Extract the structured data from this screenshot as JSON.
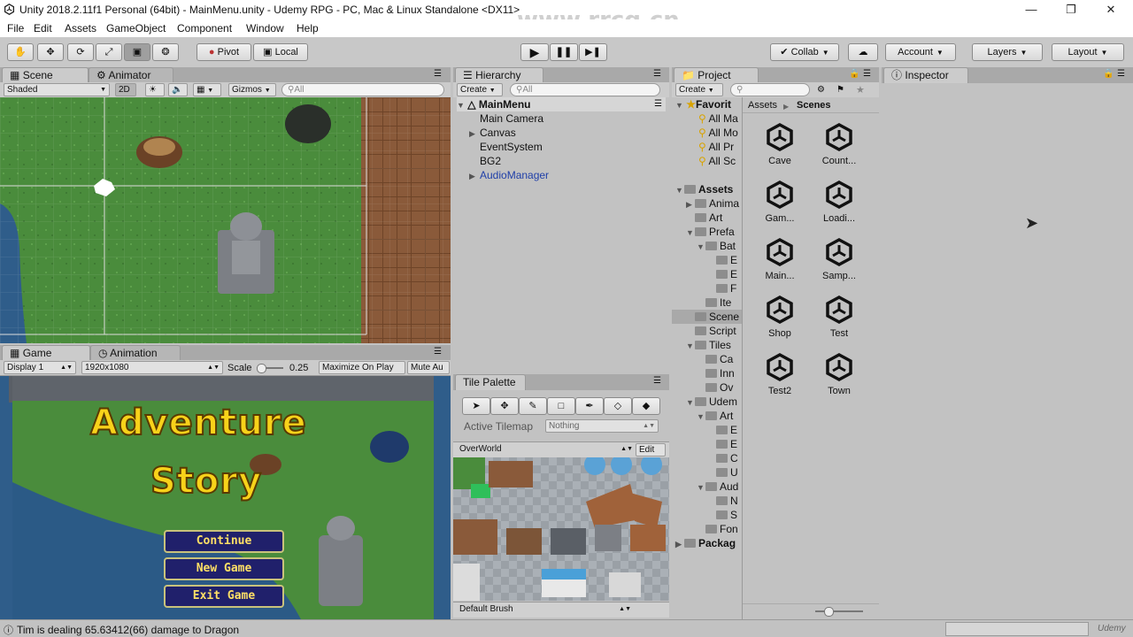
{
  "window": {
    "title": "Unity 2018.2.11f1 Personal (64bit) - MainMenu.unity - Udemy RPG - PC, Mac & Linux Standalone <DX11>"
  },
  "watermark": {
    "text": "www.rrcg.cn"
  },
  "menu": [
    "File",
    "Edit",
    "Assets",
    "GameObject",
    "Component",
    "Window",
    "Help"
  ],
  "toolbar": {
    "pivot": "Pivot",
    "local": "Local",
    "collab": "Collab",
    "account": "Account",
    "layers": "Layers",
    "layout": "Layout"
  },
  "scene_panel": {
    "tabs": [
      "Scene",
      "Animator"
    ],
    "shading": "Shaded",
    "mode2d": "2D",
    "gizmos": "Gizmos",
    "search_placeholder": "All"
  },
  "game_panel": {
    "tabs": [
      "Game",
      "Animation"
    ],
    "display": "Display 1",
    "resolution": "1920x1080",
    "scale_label": "Scale",
    "scale_value": "0.25",
    "maximize": "Maximize On Play",
    "mute": "Mute Au",
    "title_line1": "Adventure",
    "title_line2": "Story",
    "buttons": [
      "Continue",
      "New Game",
      "Exit Game"
    ]
  },
  "hierarchy": {
    "tab": "Hierarchy",
    "create": "Create",
    "search_placeholder": "All",
    "scene": "MainMenu",
    "items": [
      {
        "label": "Main Camera",
        "expandable": false,
        "prefab": false
      },
      {
        "label": "Canvas",
        "expandable": true,
        "prefab": false
      },
      {
        "label": "EventSystem",
        "expandable": false,
        "prefab": false
      },
      {
        "label": "BG2",
        "expandable": false,
        "prefab": false
      },
      {
        "label": "AudioManager",
        "expandable": true,
        "prefab": true
      }
    ]
  },
  "tile_palette": {
    "tab": "Tile Palette",
    "active_tilemap_label": "Active Tilemap",
    "active_tilemap_value": "Nothing",
    "palette": "OverWorld",
    "edit": "Edit",
    "brush": "Default Brush"
  },
  "project": {
    "tab": "Project",
    "create": "Create",
    "breadcrumb": [
      "Assets",
      "Scenes"
    ],
    "favorites_label": "Favorit",
    "favorites": [
      "All Ma",
      "All Mo",
      "All Pr",
      "All Sc"
    ],
    "tree": [
      {
        "label": "Assets",
        "depth": 0,
        "bold": true,
        "arrow": "down"
      },
      {
        "label": "Anima",
        "depth": 1,
        "arrow": "right"
      },
      {
        "label": "Art",
        "depth": 1,
        "arrow": ""
      },
      {
        "label": "Prefa",
        "depth": 1,
        "arrow": "down"
      },
      {
        "label": "Bat",
        "depth": 2,
        "arrow": "down"
      },
      {
        "label": "E",
        "depth": 3,
        "arrow": ""
      },
      {
        "label": "E",
        "depth": 3,
        "arrow": ""
      },
      {
        "label": "F",
        "depth": 3,
        "arrow": ""
      },
      {
        "label": "Ite",
        "depth": 2,
        "arrow": ""
      },
      {
        "label": "Scene",
        "depth": 1,
        "arrow": "",
        "selected": true
      },
      {
        "label": "Script",
        "depth": 1,
        "arrow": ""
      },
      {
        "label": "Tiles",
        "depth": 1,
        "arrow": "down"
      },
      {
        "label": "Ca",
        "depth": 2,
        "arrow": ""
      },
      {
        "label": "Inn",
        "depth": 2,
        "arrow": ""
      },
      {
        "label": "Ov",
        "depth": 2,
        "arrow": ""
      },
      {
        "label": "Udem",
        "depth": 1,
        "arrow": "down"
      },
      {
        "label": "Art",
        "depth": 2,
        "arrow": "down"
      },
      {
        "label": "E",
        "depth": 3,
        "arrow": ""
      },
      {
        "label": "E",
        "depth": 3,
        "arrow": ""
      },
      {
        "label": "C",
        "depth": 3,
        "arrow": ""
      },
      {
        "label": "U",
        "depth": 3,
        "arrow": ""
      },
      {
        "label": "Aud",
        "depth": 2,
        "arrow": "down"
      },
      {
        "label": "N",
        "depth": 3,
        "arrow": ""
      },
      {
        "label": "S",
        "depth": 3,
        "arrow": ""
      },
      {
        "label": "Fon",
        "depth": 2,
        "arrow": ""
      },
      {
        "label": "Packag",
        "depth": 0,
        "bold": true,
        "arrow": "right"
      }
    ],
    "assets": [
      "Cave",
      "Count...",
      "Gam...",
      "Loadi...",
      "Main...",
      "Samp...",
      "Shop",
      "Test",
      "Test2",
      "Town"
    ]
  },
  "inspector": {
    "tab": "Inspector"
  },
  "status": {
    "message": "Tim is dealing 65.63412(66) damage to Dragon",
    "brand": "Udemy"
  }
}
